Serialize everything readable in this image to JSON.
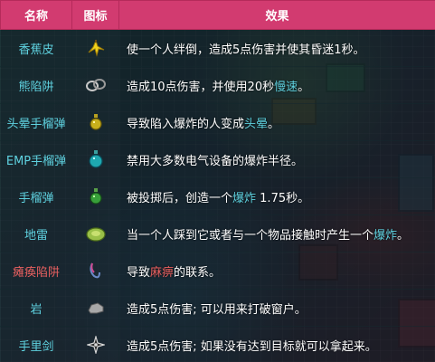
{
  "header": {
    "name": "名称",
    "icon": "图标",
    "effect": "效果"
  },
  "rows": [
    {
      "name": "香蕉皮",
      "icon": "banana-peel-icon",
      "effect": [
        {
          "text": "使一个人绊倒，造成5点伤害并使其昏迷1秒。",
          "style": "plain"
        }
      ]
    },
    {
      "name": "熊陷阱",
      "icon": "bear-trap-icon",
      "effect": [
        {
          "text": "造成10点伤害，并使用20秒",
          "style": "plain"
        },
        {
          "text": "慢速",
          "style": "link"
        },
        {
          "text": "。",
          "style": "plain"
        }
      ]
    },
    {
      "name": "头晕手榴弹",
      "icon": "dizzy-grenade-icon",
      "effect": [
        {
          "text": "导致陷入爆炸的人变成",
          "style": "plain"
        },
        {
          "text": "头晕",
          "style": "link"
        },
        {
          "text": "。",
          "style": "plain"
        }
      ]
    },
    {
      "name": "EMP手榴弹",
      "icon": "emp-grenade-icon",
      "effect": [
        {
          "text": "禁用大多数电气设备的爆炸半径。",
          "style": "plain"
        }
      ]
    },
    {
      "name": "手榴弹",
      "icon": "grenade-icon",
      "effect": [
        {
          "text": "被投掷后，创造一个",
          "style": "plain"
        },
        {
          "text": "爆炸",
          "style": "link"
        },
        {
          "text": " 1.75秒。",
          "style": "plain"
        }
      ]
    },
    {
      "name": "地雷",
      "icon": "landmine-icon",
      "effect": [
        {
          "text": "当一个人踩到它或者与一个物品接触时产生一个",
          "style": "plain"
        },
        {
          "text": "爆炸",
          "style": "link"
        },
        {
          "text": "。",
          "style": "plain"
        }
      ]
    },
    {
      "name": "瘫痪陷阱",
      "name_style": "red",
      "icon": "paralyzer-trap-icon",
      "effect": [
        {
          "text": "导致",
          "style": "plain"
        },
        {
          "text": "麻痹",
          "style": "redlink"
        },
        {
          "text": "的联系。",
          "style": "plain"
        }
      ]
    },
    {
      "name": "岩",
      "icon": "rock-icon",
      "effect": [
        {
          "text": "造成5点伤害; 可以用来打破窗户。",
          "style": "plain"
        }
      ]
    },
    {
      "name": "手里剑",
      "icon": "shuriken-icon",
      "effect": [
        {
          "text": "造成5点伤害; 如果没有达到目标就可以拿起来。",
          "style": "plain"
        }
      ]
    }
  ],
  "colors": {
    "header_bg": "#d23b70",
    "link": "#5fd2e0",
    "red_link": "#e86060"
  }
}
